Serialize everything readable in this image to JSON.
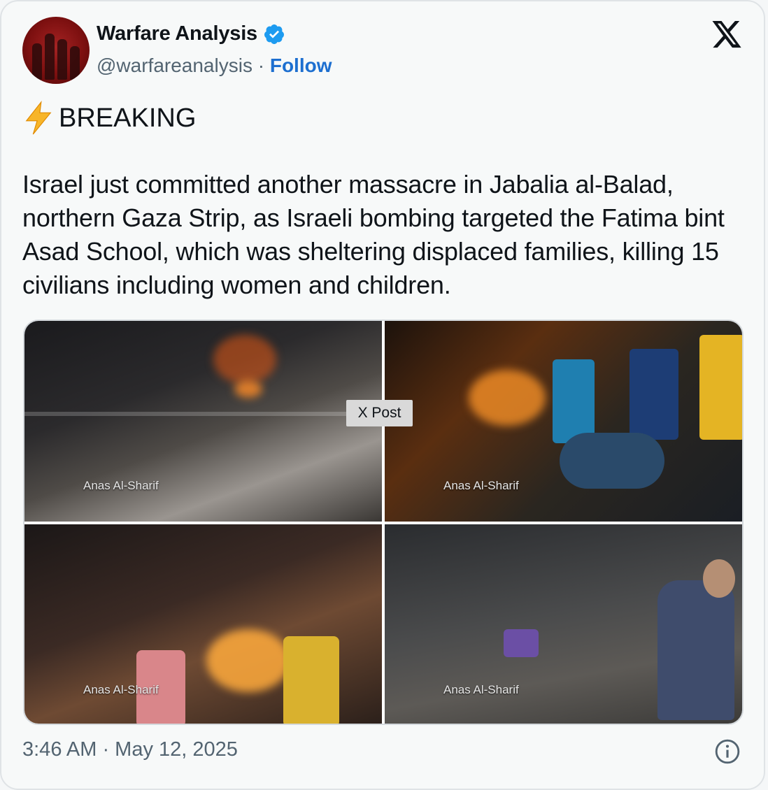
{
  "author": {
    "name": "Warfare Analysis",
    "handle": "@warfareanalysis",
    "separator": "·",
    "follow_label": "Follow",
    "verified": true
  },
  "post": {
    "headline": "BREAKING",
    "headline_icon": "lightning-bolt-emoji",
    "body": "Israel just committed another massacre in Jabalia al-Balad, northern Gaza Strip, as Israeli bombing targeted the Fatima bint Asad School, which was sheltering displaced families, killing 15 civilians including women and children.",
    "media_badge": "X Post",
    "media": [
      {
        "credit": "Anas Al-Sharif"
      },
      {
        "credit": "Anas Al-Sharif"
      },
      {
        "credit": "Anas Al-Sharif"
      },
      {
        "credit": "Anas Al-Sharif"
      }
    ],
    "timestamp": "3:46 AM · May 12, 2025"
  },
  "icons": {
    "platform": "x-logo-icon",
    "verified": "verified-badge-icon",
    "info": "info-icon"
  },
  "colors": {
    "follow": "#1d6fd0",
    "verified": "#1d9bf0",
    "secondary_text": "#536471",
    "card_background": "#f7f9f9"
  }
}
